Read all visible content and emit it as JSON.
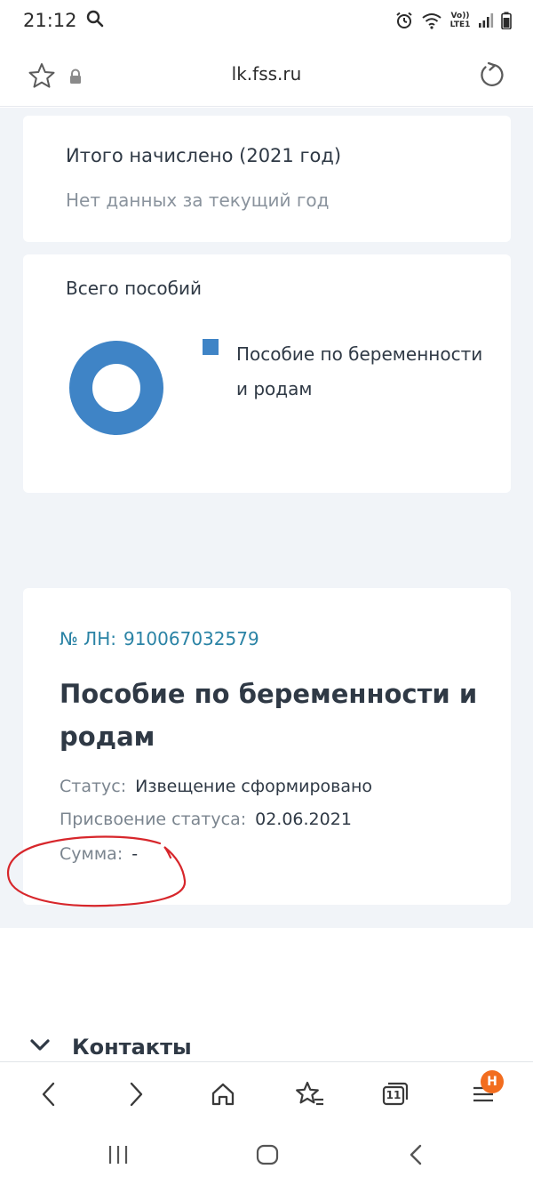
{
  "status_bar": {
    "time": "21:12",
    "network": "Vo)) LTE1"
  },
  "address_bar": {
    "url": "lk.fss.ru"
  },
  "total_card": {
    "title": "Итого начислено (2021 год)",
    "subtitle": "Нет данных за текущий год"
  },
  "chart_card": {
    "title": "Всего пособий",
    "chart_data": {
      "type": "pie",
      "categories": [
        "Пособие по беременности и родам"
      ],
      "values": [
        1
      ],
      "colors": [
        "#3f84c6"
      ],
      "legend": "right"
    },
    "legend_label": "Пособие по беременности и родам"
  },
  "benefit_card": {
    "ln_label": "№ ЛН:",
    "ln_number": "910067032579",
    "title": "Пособие по беременности и родам",
    "status_label": "Статус:",
    "status_value": "Извещение сформировано",
    "assign_label": "Присвоение статуса:",
    "assign_value": "02.06.2021",
    "sum_label": "Сумма:",
    "sum_value": "-"
  },
  "contacts": {
    "label": "Контакты"
  },
  "toolbar": {
    "tabs_count": "11",
    "menu_badge": "Н"
  },
  "colors": {
    "accent": "#3f84c6",
    "link": "#2a83a5",
    "badge": "#f26d1f",
    "annotation": "#d7262b"
  }
}
